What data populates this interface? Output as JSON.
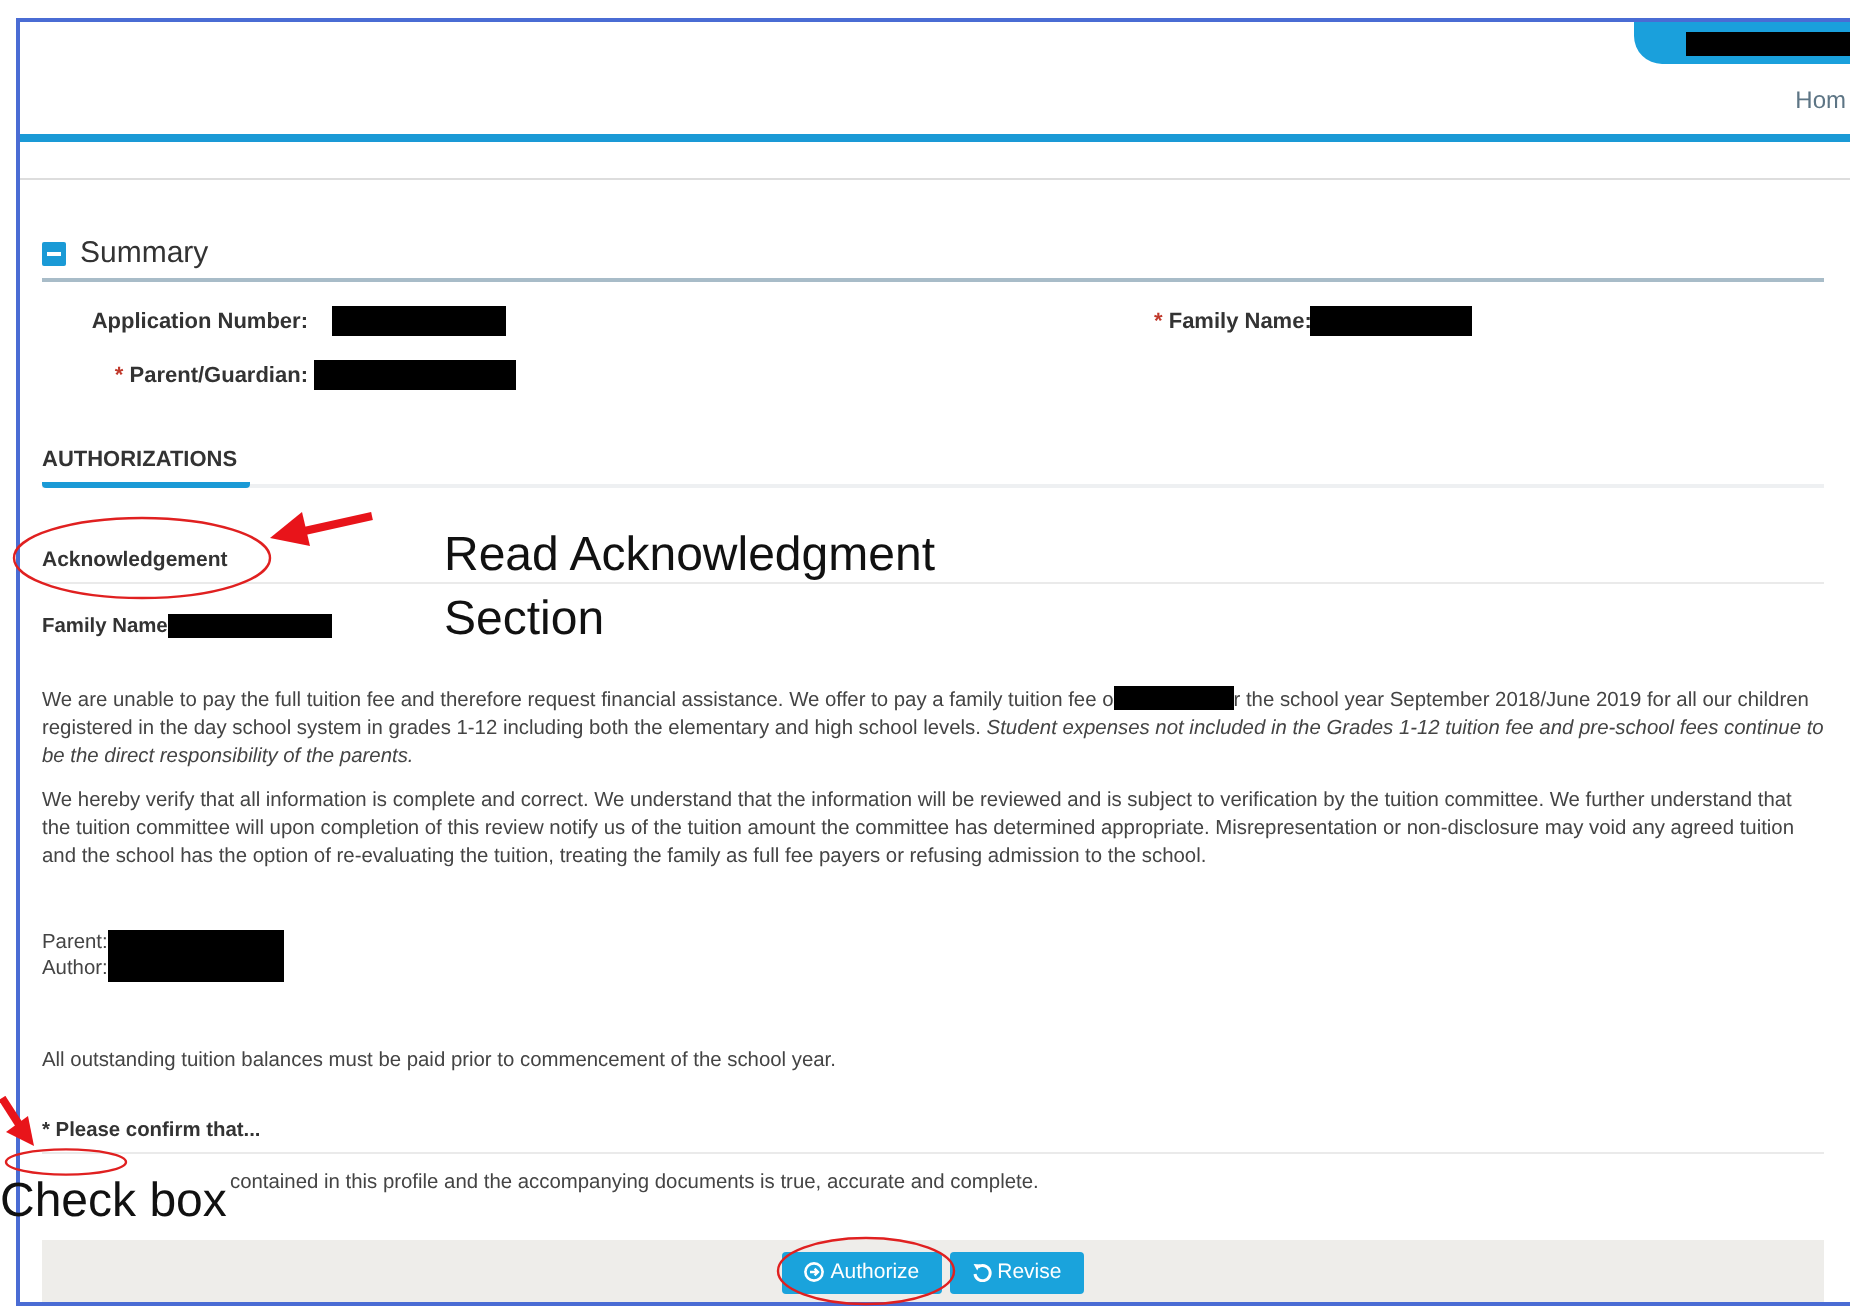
{
  "header": {
    "nav_link": "Hom"
  },
  "summary": {
    "title": "Summary",
    "expanded": true,
    "fields": [
      {
        "label": "Application Number:"
      },
      {
        "label": "Family Name:",
        "mark": "*"
      },
      {
        "label": "Parent/Guardian:",
        "mark": "*"
      }
    ]
  },
  "tabs": [
    {
      "label": "AUTHORIZATIONS",
      "selected": true
    }
  ],
  "acknowledgement": {
    "heading": "Acknowledgement",
    "family_name_label": "Family Name",
    "paragraphs": [
      {
        "parts": [
          "We are unable to pay the full tuition fee and therefore request financial assistance. We offer to pay a family tuition fee o",
          "r the school year September 2018/June 2019 for all our children registered in the day school system in grades 1-12 including both the elementary and high school levels. *Student expenses not included in the Grades 1-12 tuition fee and pre-school fees continue to be the direct responsibility of the parents.*"
        ]
      },
      {
        "parts": [
          "We hereby verify that all information is complete and correct. We understand that the information will be reviewed and is subject to verification by the tuition committee. We further understand that the tuition committee will upon completion of this review notify us of the tuition amount the committee has determined appropriate. Misrepresentation or non-disclosure may void any agreed tuition and the school has the option of re-evaluating the tuition, treating the family as full fee payers or refusing admission to the school."
        ]
      }
    ],
    "signatures": [
      {
        "label": "Parent:"
      },
      {
        "label": "Author:"
      }
    ],
    "notice": "All outstanding tuition balances must be paid prior to commencement of the school year.",
    "confirm_heading": "* Please confirm that...",
    "confirm_text": "contained in this profile and the accompanying documents is true, accurate and complete."
  },
  "buttons": [
    {
      "label": "Authorize",
      "kind": "authorize"
    },
    {
      "label": "Revise",
      "kind": "revise"
    }
  ],
  "annotations": [
    {
      "kind": "callout",
      "text": "Read Acknowledgment Section"
    },
    {
      "kind": "label",
      "text": "Check box"
    }
  ]
}
